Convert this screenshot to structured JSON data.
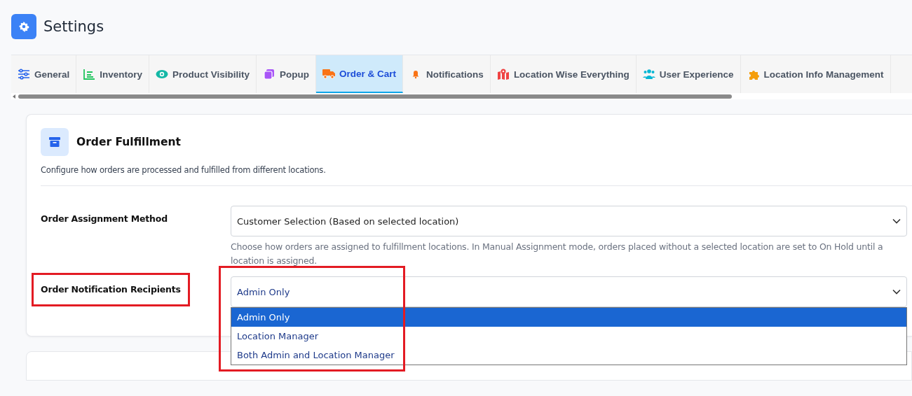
{
  "page": {
    "title": "Settings"
  },
  "tabs": [
    {
      "label": "General",
      "selected": false
    },
    {
      "label": "Inventory",
      "selected": false
    },
    {
      "label": "Product Visibility",
      "selected": false
    },
    {
      "label": "Popup",
      "selected": false
    },
    {
      "label": "Order & Cart",
      "selected": true
    },
    {
      "label": "Notifications",
      "selected": false
    },
    {
      "label": "Location Wise Everything",
      "selected": false
    },
    {
      "label": "User Experience",
      "selected": false
    },
    {
      "label": "Location Info Management",
      "selected": false
    }
  ],
  "section": {
    "title": "Order Fulfillment",
    "description": "Configure how orders are processed and fulfilled from different locations.",
    "fields": [
      {
        "label": "Order Assignment Method",
        "value": "Customer Selection (Based on selected location)",
        "help": "Choose how orders are assigned to fulfillment locations. In Manual Assignment mode, orders placed without a selected location are set to On Hold until a location is assigned.",
        "expanded": false
      },
      {
        "label": "Order Notification Recipients",
        "value": "Admin Only",
        "highlighted": true,
        "expanded": true,
        "options": [
          {
            "label": "Admin Only",
            "selected": true
          },
          {
            "label": "Location Manager",
            "selected": false
          },
          {
            "label": "Both Admin and Location Manager",
            "selected": false
          }
        ]
      }
    ]
  }
}
